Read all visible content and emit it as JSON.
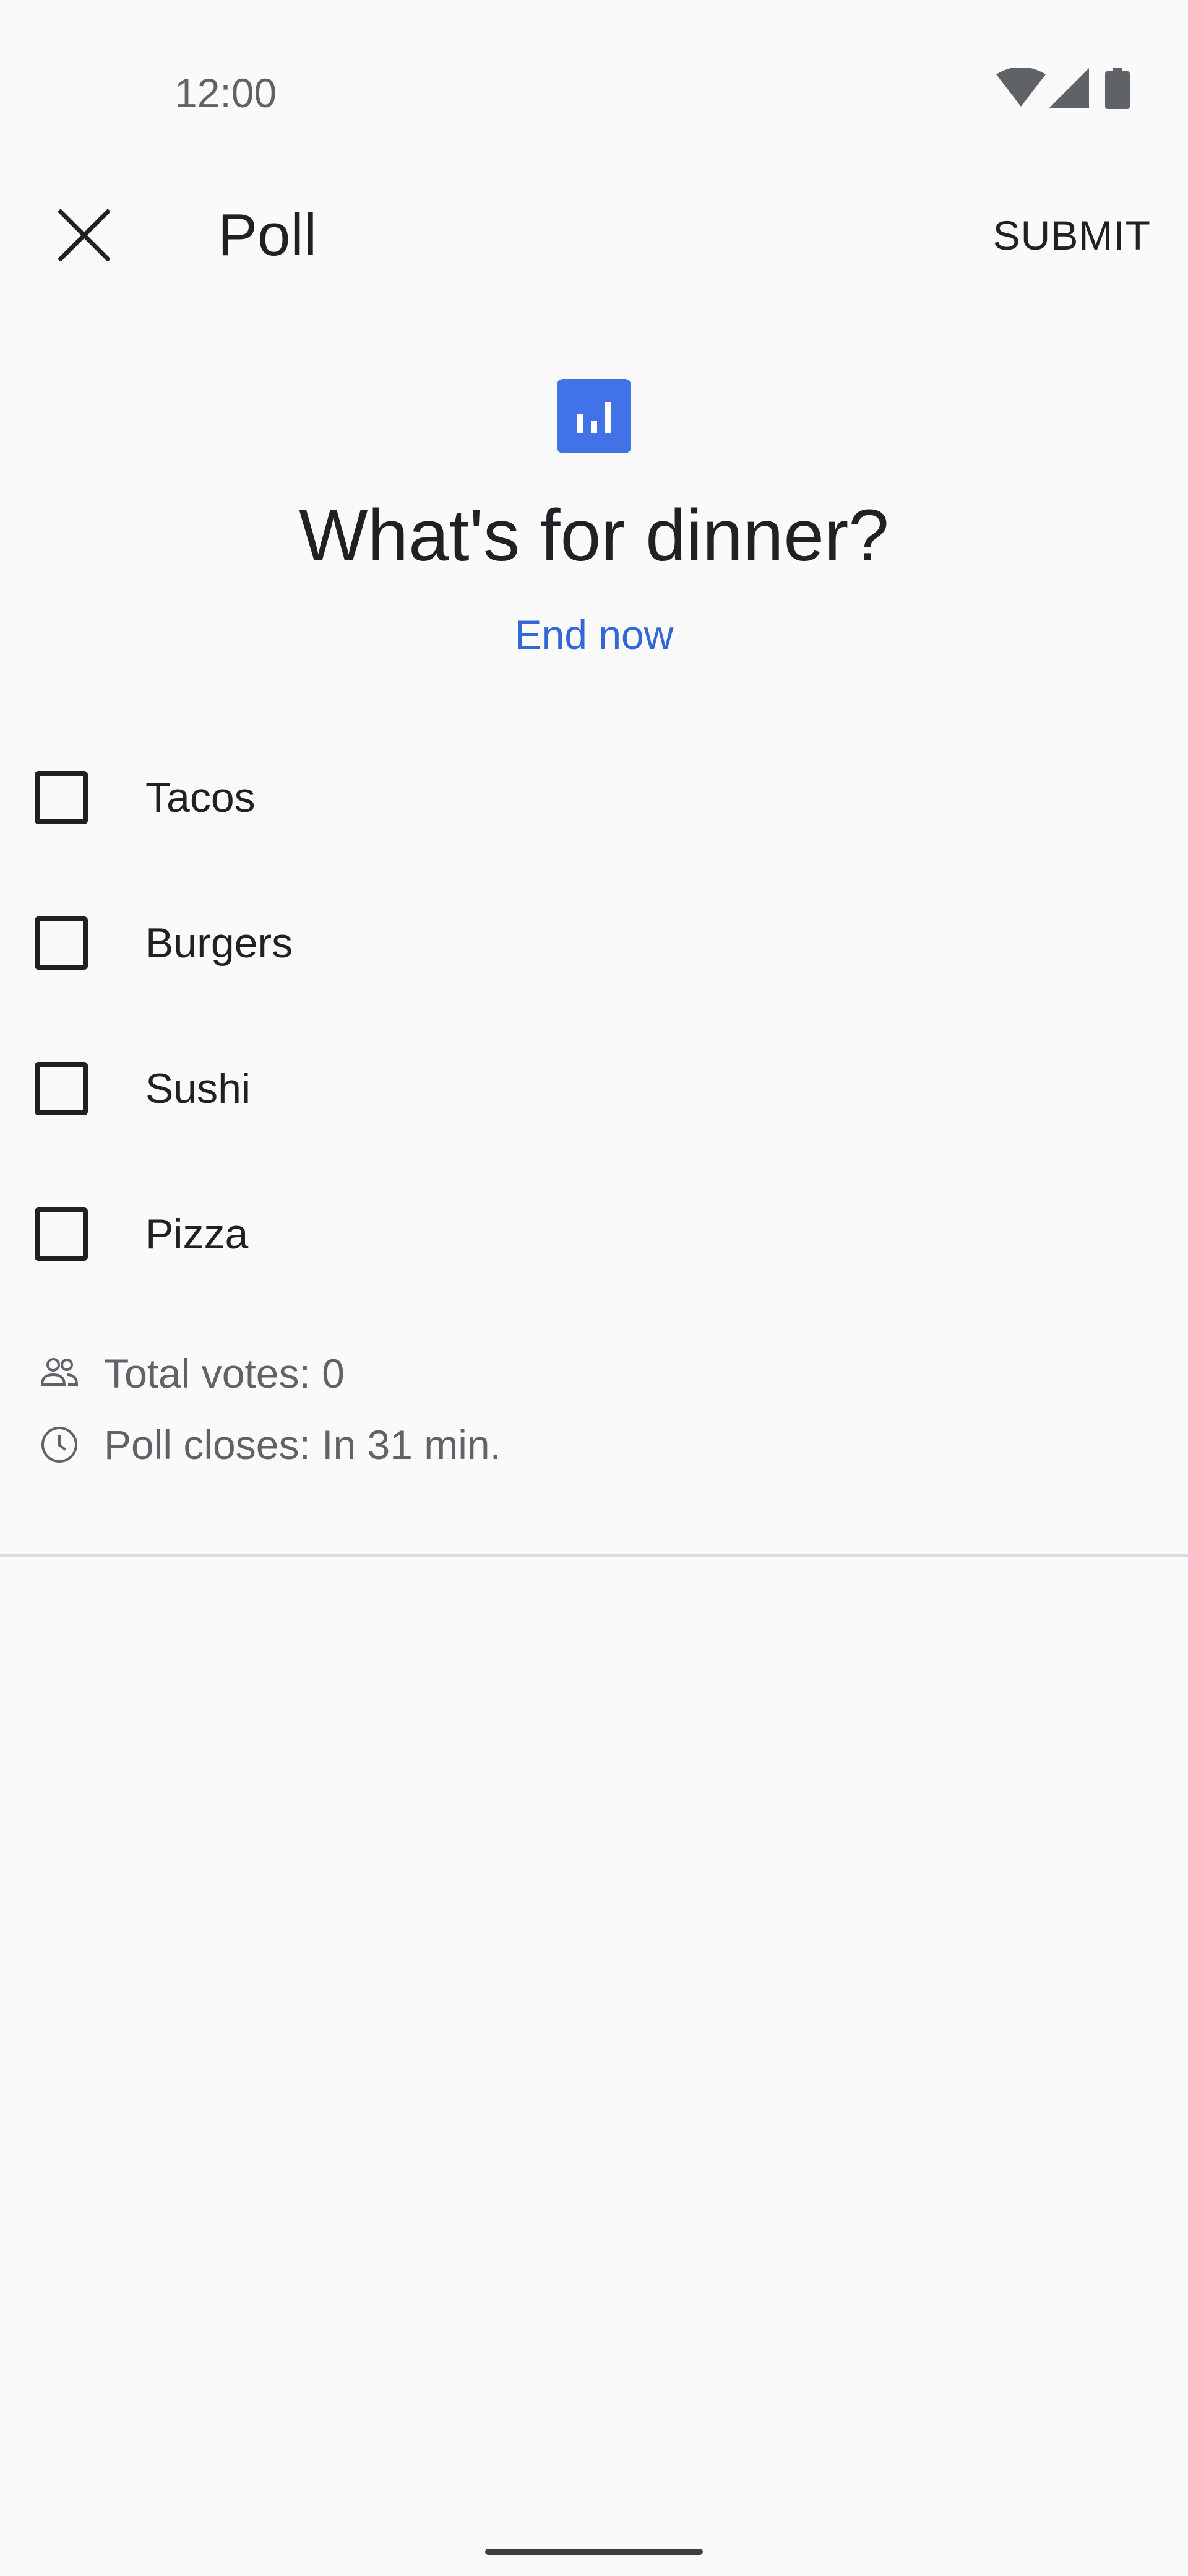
{
  "status_bar": {
    "time": "12:00",
    "icons": [
      "wifi-icon",
      "cellular-signal-icon",
      "battery-icon"
    ]
  },
  "app_bar": {
    "close_icon": "close-icon",
    "title": "Poll",
    "submit_label": "SUBMIT"
  },
  "poll": {
    "icon": "poll-chart-icon",
    "icon_color": "#4272e8",
    "question": "What's for dinner?",
    "end_now_label": "End now",
    "link_color": "#3367d6",
    "options": [
      {
        "label": "Tacos",
        "checked": false
      },
      {
        "label": "Burgers",
        "checked": false
      },
      {
        "label": "Sushi",
        "checked": false
      },
      {
        "label": "Pizza",
        "checked": false
      }
    ]
  },
  "stats": {
    "total_votes_label": "Total votes:",
    "total_votes_value": "0",
    "poll_closes_label": "Poll closes:",
    "poll_closes_value": "In 31 min."
  }
}
